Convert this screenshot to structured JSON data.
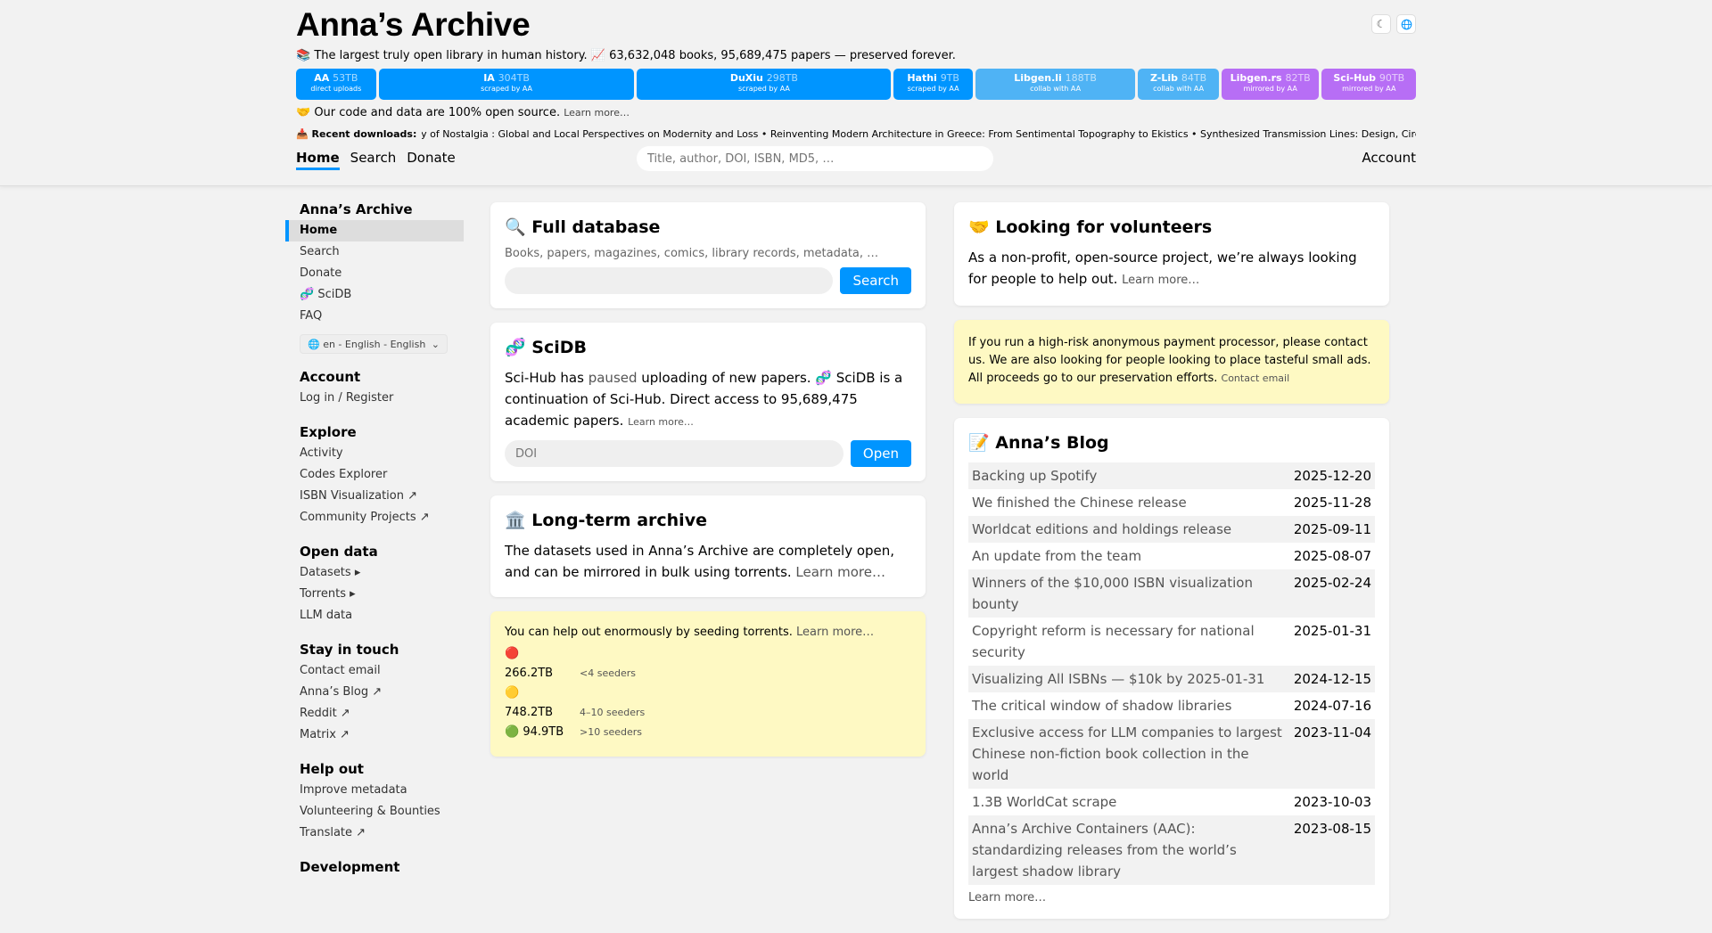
{
  "header": {
    "title": "Anna’s Archive",
    "tagline": "📚 The largest truly open library in human history. 📈 63,632,048 books, 95,689,475 papers — preserved forever.",
    "icons": [
      "moon-icon",
      "globe-icon"
    ],
    "stats": [
      {
        "name": "AA",
        "size": "53TB",
        "sub": "direct uploads",
        "color": "#0095ff"
      },
      {
        "name": "IA",
        "size": "304TB",
        "sub": "scraped by AA",
        "color": "#0095ff"
      },
      {
        "name": "DuXiu",
        "size": "298TB",
        "sub": "scraped by AA",
        "color": "#0095ff"
      },
      {
        "name": "Hathi",
        "size": "9TB",
        "sub": "scraped by AA",
        "color": "#0095ff"
      },
      {
        "name": "Libgen.li",
        "size": "188TB",
        "sub": "collab with AA",
        "color": "#4fb3f5"
      },
      {
        "name": "Z-Lib",
        "size": "84TB",
        "sub": "collab with AA",
        "color": "#4fb3f5"
      },
      {
        "name": "Libgen.rs",
        "size": "82TB",
        "sub": "mirrored by AA",
        "color": "#b76ef5"
      },
      {
        "name": "Sci-Hub",
        "size": "90TB",
        "sub": "mirrored by AA",
        "color": "#b76ef5"
      }
    ],
    "opensource_text": "🤝 Our code and data are 100% open source.",
    "opensource_link": "Learn more…",
    "recent_label": "📥 Recent downloads:",
    "recent_text": "ay of Nostalgia : Global and Local Perspectives on Modernity and Loss • Reinventing Modern Architecture in Greece: From Sentimental Topography to Ekistics • Synthesized Transmission Lines: Design, Circuit Implement"
  },
  "nav": {
    "tabs": [
      "Home",
      "Search",
      "Donate"
    ],
    "search_placeholder": "Title, author, DOI, ISBN, MD5, …",
    "account": "Account"
  },
  "sidebar": {
    "sections": [
      {
        "head": "Anna’s Archive",
        "items": [
          "Home",
          "Search",
          "Donate",
          "🧬 SciDB",
          "FAQ"
        ]
      },
      {
        "head": "Account",
        "items": [
          "Log in / Register"
        ]
      },
      {
        "head": "Explore",
        "items": [
          "Activity",
          "Codes Explorer",
          "ISBN Visualization ↗",
          "Community Projects ↗"
        ]
      },
      {
        "head": "Open data",
        "items": [
          "Datasets ▸",
          "Torrents ▸",
          "LLM data"
        ]
      },
      {
        "head": "Stay in touch",
        "items": [
          "Contact email",
          "Anna’s Blog ↗",
          "Reddit ↗",
          "Matrix ↗"
        ]
      },
      {
        "head": "Help out",
        "items": [
          "Improve metadata",
          "Volunteering & Bounties",
          "Translate ↗"
        ]
      },
      {
        "head": "Development",
        "items": []
      }
    ],
    "language": "🌐 en - English - English"
  },
  "full_db": {
    "title": "🔍 Full database",
    "desc": "Books, papers, magazines, comics, library records, metadata, …",
    "button": "Search"
  },
  "scidb": {
    "title": "🧬 SciDB",
    "text_pre": "Sci-Hub has ",
    "text_link": "paused",
    "text_post": " uploading of new papers. 🧬 SciDB is a continuation of Sci-Hub. Direct access to 95,689,475 academic papers. ",
    "learn_more": "Learn more…",
    "placeholder": "DOI",
    "button": "Open"
  },
  "longterm": {
    "title": "🏛️ Long-term archive",
    "text": "The datasets used in Anna’s Archive are completely open, and can be mirrored in bulk using torrents. ",
    "learn_more": "Learn more…"
  },
  "seeding": {
    "text": "You can help out enormously by seeding torrents. ",
    "learn_more": "Learn more…",
    "rows": [
      {
        "size": "🔴 266.2TB",
        "count": "<4 seeders"
      },
      {
        "size": "🟡 748.2TB",
        "count": "4–10 seeders"
      },
      {
        "size": "🟢 94.9TB",
        "count": ">10 seeders"
      }
    ]
  },
  "volunteers": {
    "title": "🤝 Looking for volunteers",
    "text": "As a non-profit, open-source project, we’re always looking for people to help out. ",
    "learn_more": "Learn more…"
  },
  "ads": {
    "text": "If you run a high-risk anonymous payment processor, please contact us. We are also looking for people looking to place tasteful small ads. All proceeds go to our preservation efforts. ",
    "link": "Contact email"
  },
  "blog": {
    "title": "📝 Anna’s Blog",
    "posts": [
      {
        "title": "Backing up Spotify",
        "date": "2025-12-20"
      },
      {
        "title": "We finished the Chinese release",
        "date": "2025-11-28"
      },
      {
        "title": "Worldcat editions and holdings release",
        "date": "2025-09-11"
      },
      {
        "title": "An update from the team",
        "date": "2025-08-07"
      },
      {
        "title": "Winners of the $10,000 ISBN visualization bounty",
        "date": "2025-02-24"
      },
      {
        "title": "Copyright reform is necessary for national security",
        "date": "2025-01-31"
      },
      {
        "title": "Visualizing All ISBNs — $10k by 2025-01-31",
        "date": "2024-12-15"
      },
      {
        "title": "The critical window of shadow libraries",
        "date": "2024-07-16"
      },
      {
        "title": "Exclusive access for LLM companies to largest Chinese non-fiction book collection in the world",
        "date": "2023-11-04"
      },
      {
        "title": "1.3B WorldCat scrape",
        "date": "2023-10-03"
      },
      {
        "title": "Anna’s Archive Containers (AAC): standardizing releases from the world’s largest shadow library",
        "date": "2023-08-15"
      }
    ],
    "learn_more": "Learn more…"
  }
}
